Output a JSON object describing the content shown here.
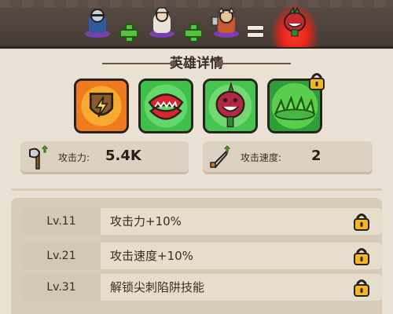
{
  "title": "英雄详情",
  "merge": {
    "heroes": [
      "knight-hero",
      "archer-hero",
      "viking-hero"
    ],
    "result": "plant-monster-hero",
    "operators": [
      "+",
      "+",
      "="
    ]
  },
  "skills": [
    {
      "name": "lightning-shield-skill",
      "locked": false
    },
    {
      "name": "chomp-plant-skill",
      "locked": false
    },
    {
      "name": "plant-monster-skill",
      "locked": false
    },
    {
      "name": "spike-trap-skill",
      "locked": true
    }
  ],
  "stats": [
    {
      "icon": "axe-icon",
      "label": "攻击力:",
      "value": "5.4K"
    },
    {
      "icon": "sword-speed-icon",
      "label": "攻击速度:",
      "value": "2"
    }
  ],
  "levels": [
    {
      "level": "Lv.11",
      "desc": "攻击力+10%",
      "locked": true
    },
    {
      "level": "Lv.21",
      "desc": "攻击速度+10%",
      "locked": true
    },
    {
      "level": "Lv.31",
      "desc": "解锁尖刺陷阱技能",
      "locked": true
    }
  ],
  "colors": {
    "accent_green": "#56c23d",
    "lock_gold": "#f2b81f",
    "header_brown": "#473b35"
  }
}
